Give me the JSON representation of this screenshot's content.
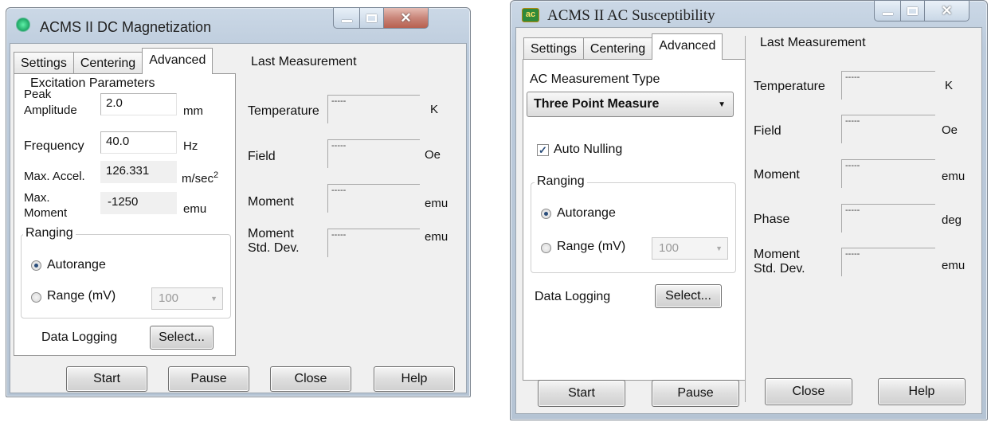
{
  "dc": {
    "title": "ACMS II DC Magnetization",
    "tabs": [
      "Settings",
      "Centering",
      "Advanced"
    ],
    "excitation_title": "Excitation Parameters",
    "peak_amp_label_1": "Peak",
    "peak_amp_label_2": "Amplitude",
    "peak_amp_value": "2.0",
    "peak_amp_unit": "mm",
    "frequency_label": "Frequency",
    "frequency_value": "40.0",
    "frequency_unit": "Hz",
    "max_accel_label": "Max. Accel.",
    "max_accel_value": "126.331",
    "max_accel_unit": "m/sec",
    "max_accel_unit_sup": "2",
    "max_moment_label_1": "Max.",
    "max_moment_label_2": "Moment",
    "max_moment_value": "-1250",
    "max_moment_unit": "emu",
    "ranging_title": "Ranging",
    "autorange_label": "Autorange",
    "range_label": "Range (mV)",
    "range_value": "100",
    "data_logging_label": "Data Logging",
    "select_button": "Select...",
    "last_measurement_title": "Last Measurement",
    "temp_label": "Temperature",
    "temp_value": "-----",
    "temp_unit": "K",
    "field_label": "Field",
    "field_value": "-----",
    "field_unit": "Oe",
    "moment_label": "Moment",
    "moment_value": "-----",
    "moment_unit": "emu",
    "std_label_1": "Moment",
    "std_label_2": "Std. Dev.",
    "std_value": "-----",
    "std_unit": "emu",
    "buttons": {
      "start": "Start",
      "pause": "Pause",
      "close": "Close",
      "help": "Help"
    }
  },
  "ac": {
    "title": "ACMS II AC Susceptibility",
    "icon_text": "ac",
    "tabs": [
      "Settings",
      "Centering",
      "Advanced"
    ],
    "measurement_type_label": "AC Measurement Type",
    "measurement_type_value": "Three Point Measure",
    "auto_nulling_label": "Auto Nulling",
    "auto_nulling_checked": true,
    "ranging_title": "Ranging",
    "autorange_label": "Autorange",
    "range_label": "Range (mV)",
    "range_value": "100",
    "data_logging_label": "Data Logging",
    "select_button": "Select...",
    "last_measurement_title": "Last Measurement",
    "temp_label": "Temperature",
    "temp_value": "-----",
    "temp_unit": "K",
    "field_label": "Field",
    "field_value": "-----",
    "field_unit": "Oe",
    "moment_label": "Moment",
    "moment_value": "-----",
    "moment_unit": "emu",
    "phase_label": "Phase",
    "phase_value": "-----",
    "phase_unit": "deg",
    "std_label_1": "Moment",
    "std_label_2": "Std. Dev.",
    "std_value": "-----",
    "std_unit": "emu",
    "buttons": {
      "start": "Start",
      "pause": "Pause",
      "close": "Close",
      "help": "Help"
    }
  },
  "colors": {
    "ac_icon_bg": "#2f8a3a",
    "dc_icon_glow": "#2fc07a",
    "close_button": "#c0604f"
  }
}
